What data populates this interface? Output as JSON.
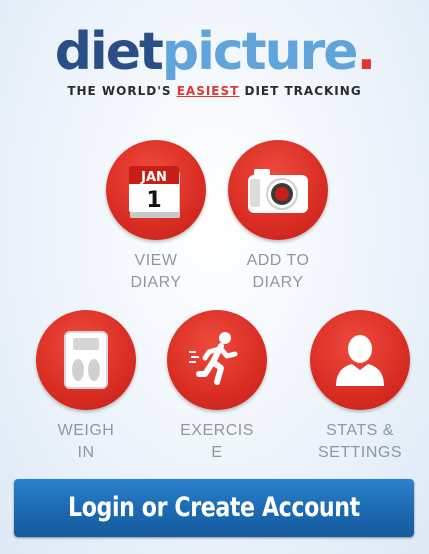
{
  "logo": {
    "diet": "diet",
    "picture": "picture",
    "dot": "."
  },
  "tagline": {
    "before": "THE WORLD'S ",
    "emphasis": "EASIEST",
    "after": " DIET TRACKING"
  },
  "calendar": {
    "month": "JAN",
    "day": "1"
  },
  "tiles": {
    "view_diary": {
      "line1": "VIEW",
      "line2": "DIARY",
      "icon": "calendar-icon"
    },
    "add_to_diary": {
      "line1": "ADD TO",
      "line2": "DIARY",
      "icon": "camera-icon"
    },
    "weigh_in": {
      "line1": "WEIGH",
      "line2": "IN",
      "icon": "scale-icon"
    },
    "exercise": {
      "line1": "EXERCIS",
      "line2": "E",
      "icon": "running-person-icon"
    },
    "stats_settings": {
      "line1": "STATS &",
      "line2": "SETTINGS",
      "icon": "person-silhouette-icon"
    }
  },
  "login_button": "Login or Create Account",
  "colors": {
    "accent_red": "#e1372f",
    "brand_dark_blue": "#2a4f86",
    "brand_light_blue": "#5fa4db",
    "button_blue": "#1d6bb4",
    "label_gray": "#8e97a3"
  }
}
